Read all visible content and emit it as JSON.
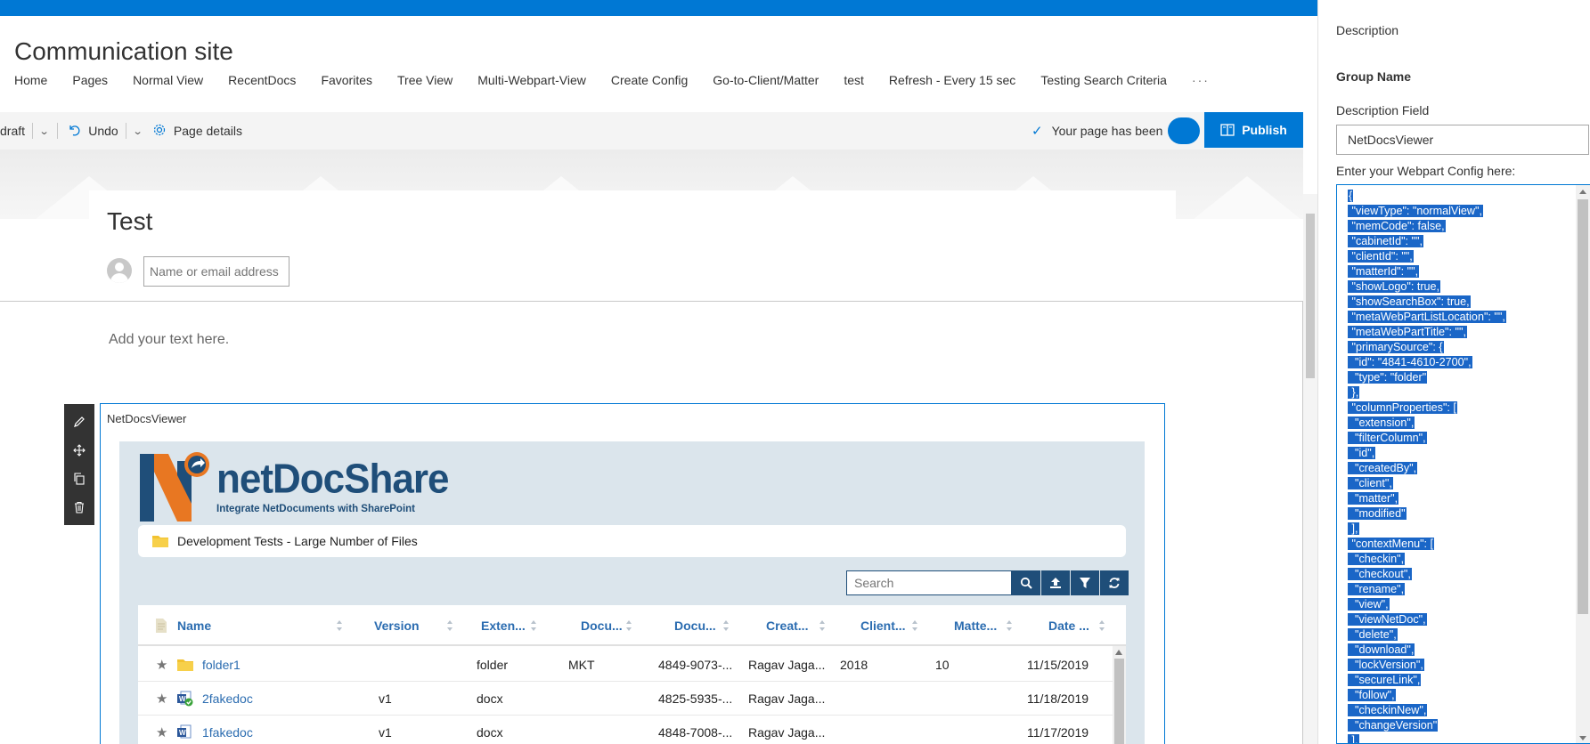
{
  "site": {
    "title": "Communication site",
    "nav": [
      "Home",
      "Pages",
      "Normal View",
      "RecentDocs",
      "Favorites",
      "Tree View",
      "Multi-Webpart-View",
      "Create Config",
      "Go-to-Client/Matter",
      "test",
      "Refresh - Every 15 sec",
      "Testing Search Criteria"
    ],
    "nav_more": "···"
  },
  "commandbar": {
    "draft_label": "draft",
    "undo_label": "Undo",
    "page_details_label": "Page details",
    "status_text": "Your page has been saved",
    "publish_label": "Publish"
  },
  "page": {
    "title": "Test",
    "author_placeholder": "Name or email address",
    "add_text_placeholder": "Add your text here."
  },
  "webpart": {
    "name": "NetDocsViewer",
    "logo_text": "netDocShare",
    "logo_tagline": "Integrate NetDocuments with SharePoint",
    "folder_path": "Development Tests - Large Number of Files",
    "search_placeholder": "Search",
    "columns": [
      "Name",
      "Version",
      "Exten...",
      "Docu...",
      "Docu...",
      "Creat...",
      "Client...",
      "Matte...",
      "Date ..."
    ],
    "rows": [
      {
        "name": "folder1",
        "type": "folder",
        "version": "",
        "extension": "folder",
        "doc_col1": "MKT",
        "doc_col2": "4849-9073-...",
        "created_by": "Ragav Jaga...",
        "client": "2018",
        "matter": "10",
        "date": "11/15/2019"
      },
      {
        "name": "2fakedoc",
        "type": "word-checked",
        "version": "v1",
        "extension": "docx",
        "doc_col1": "",
        "doc_col2": "4825-5935-...",
        "created_by": "Ragav Jaga...",
        "client": "",
        "matter": "",
        "date": "11/18/2019"
      },
      {
        "name": "1fakedoc",
        "type": "word",
        "version": "v1",
        "extension": "docx",
        "doc_col1": "",
        "doc_col2": "4848-7008-...",
        "created_by": "Ragav Jaga...",
        "client": "",
        "matter": "",
        "date": "11/17/2019"
      }
    ]
  },
  "panel": {
    "description_label": "Description",
    "group_name_label": "Group Name",
    "description_field_label": "Description Field",
    "description_field_value": "NetDocsViewer",
    "config_label": "Enter your Webpart Config here:",
    "config_lines": [
      "{",
      " \"viewType\": \"normalView\",",
      " \"memCode\": false,",
      " \"cabinetId\": \"\",",
      " \"clientId\": \"\",",
      " \"matterId\": \"\",",
      " \"showLogo\": true,",
      " \"showSearchBox\": true,",
      " \"metaWebPartListLocation\": \"\",",
      " \"metaWebPartTitle\": \"\",",
      " \"primarySource\": {",
      "  \"id\": \"4841-4610-2700\",",
      "  \"type\": \"folder\"",
      " },",
      " \"columnProperties\": [",
      "  \"extension\",",
      "  \"filterColumn\",",
      "  \"id\",",
      "  \"createdBy\",",
      "  \"client\",",
      "  \"matter\",",
      "  \"modified\"",
      " ],",
      " \"contextMenu\": [",
      "  \"checkin\",",
      "  \"checkout\",",
      "  \"rename\",",
      "  \"view\",",
      "  \"viewNetDoc\",",
      "  \"delete\",",
      "  \"download\",",
      "  \"lockVersion\",",
      "  \"secureLink\",",
      "  \"follow\",",
      "  \"checkinNew\",",
      "  \"changeVersion\"",
      " ],"
    ]
  },
  "colors": {
    "accent": "#0078d4",
    "ndv_blue": "#1f4e79",
    "ndv_link": "#2b6cb0",
    "ndv_bg": "#dbe5ec",
    "selection": "#1a66c7"
  }
}
